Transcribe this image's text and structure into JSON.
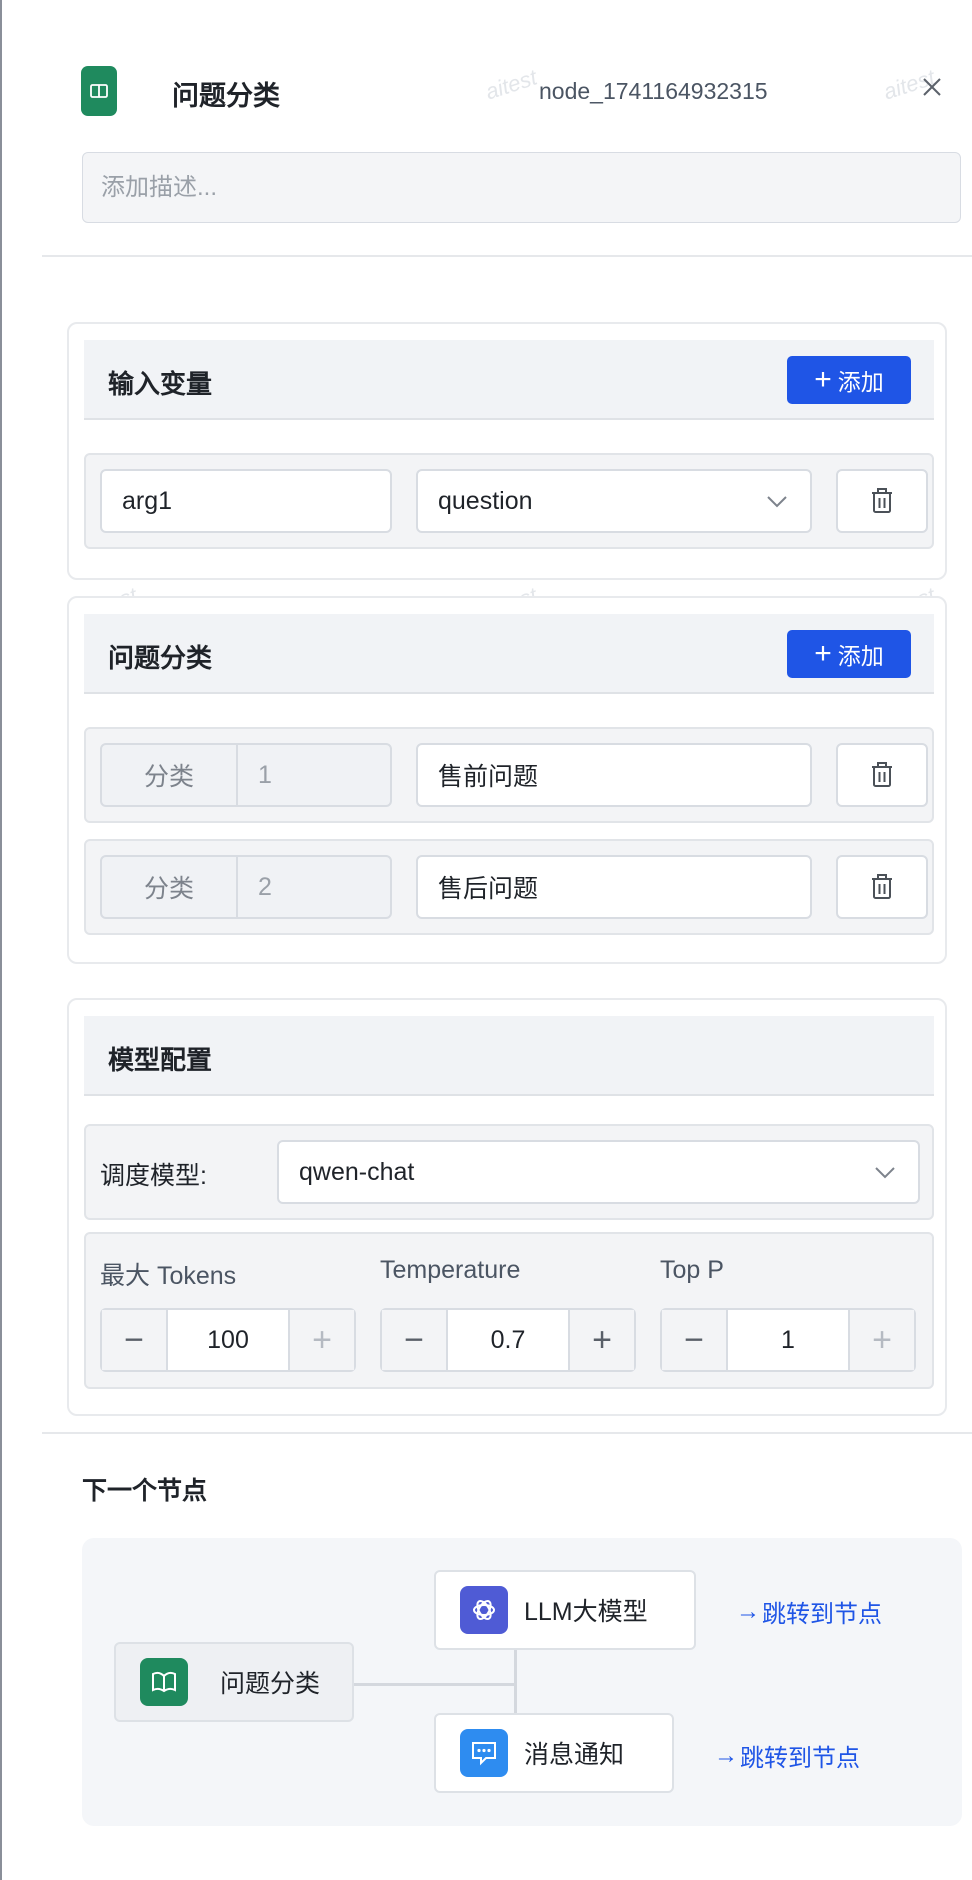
{
  "header": {
    "title": "问题分类",
    "node_id": "node_1741164932315",
    "description_placeholder": "添加描述..."
  },
  "input_vars": {
    "title": "输入变量",
    "add_label": "添加",
    "rows": [
      {
        "name": "arg1",
        "source": "question"
      }
    ]
  },
  "classify": {
    "title": "问题分类",
    "add_label": "添加",
    "rows": [
      {
        "prefix": "分类",
        "index": "1",
        "text": "售前问题"
      },
      {
        "prefix": "分类",
        "index": "2",
        "text": "售后问题"
      }
    ]
  },
  "model": {
    "title": "模型配置",
    "schedule_label": "调度模型:",
    "schedule_value": "qwen-chat",
    "params": [
      {
        "label": "最大 Tokens",
        "value": "100"
      },
      {
        "label": "Temperature",
        "value": "0.7"
      },
      {
        "label": "Top P",
        "value": "1"
      }
    ]
  },
  "next": {
    "title": "下一个节点",
    "source_node": "问题分类",
    "targets": [
      {
        "label": "LLM大模型",
        "icon": "openai-icon",
        "color": "#4f5bd5",
        "link": "跳转到节点"
      },
      {
        "label": "消息通知",
        "icon": "message-icon",
        "color": "#2e8cf0",
        "link": "跳转到节点"
      }
    ]
  },
  "watermark": "aitest",
  "colors": {
    "primary": "#1f55e6",
    "node_green": "#1f8a5e"
  }
}
